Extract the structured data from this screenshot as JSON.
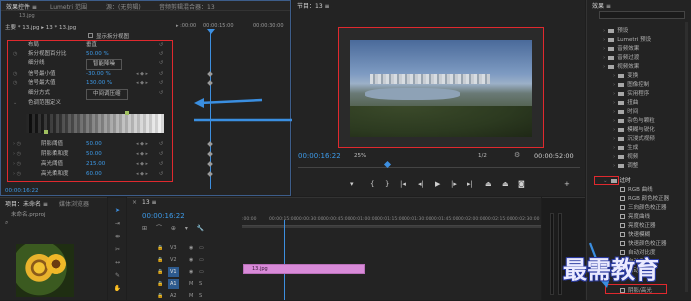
{
  "effect_controls": {
    "tabs": [
      "效果控件 ≡",
      "Lumetri 范围",
      "源：(无剪辑)",
      "音频剪辑混合器：13"
    ],
    "source_tab": "13.jpg",
    "clip_path": "主要 * 13.jpg ▸ 13 * 13.jpg",
    "timecodes": [
      "▸ :00:00",
      "00:00:15:00",
      "00:00:30:00"
    ],
    "show_split_view": "显示拆分视图",
    "rows": [
      {
        "label": "布局",
        "value": "垂直"
      },
      {
        "label": "拆分视图百分比",
        "value": "50.00 %"
      },
      {
        "label": "细分线",
        "value": "智能降噪"
      },
      {
        "label": "信号最小值",
        "value": "-30.00 %"
      },
      {
        "label": "信号最大值",
        "value": "130.00 %"
      },
      {
        "label": "细分方式",
        "value": "中间调压缩"
      },
      {
        "label": "色调范围定义",
        "value": ""
      },
      {
        "label": "阴影阈值",
        "value": "50.00"
      },
      {
        "label": "阴影柔和度",
        "value": "50.00"
      },
      {
        "label": "高光阈值",
        "value": "215.00"
      },
      {
        "label": "高光柔和度",
        "value": "60.00"
      }
    ],
    "bottom_timecode": "00:00:16:22"
  },
  "program_monitor": {
    "title": "节目：13 ≡",
    "timecode": "00:00:16:22",
    "zoom": "25%",
    "quality": "1/2",
    "duration": "00:00:52:00"
  },
  "project": {
    "tabs": [
      "项目：未命名 ≡",
      "媒体浏览器"
    ],
    "file": "未命名.prproj"
  },
  "timeline": {
    "title": "13 ≡",
    "timecode": "00:00:16:22",
    "ruler": [
      ":00:00",
      "00:00:15:00",
      "00:00:30:00",
      "00:00:45:00",
      "00:01:00:00",
      "00:01:15:00",
      "00:01:30:00",
      "00:01:45:00",
      "00:02:00:00",
      "00:02:15:00",
      "00:02:30:00"
    ],
    "tracks": [
      "V3",
      "V2",
      "V1",
      "A1",
      "A2"
    ],
    "clip": "13.jpg"
  },
  "effects_panel": {
    "title": "效果 ≡",
    "items": [
      {
        "label": "预设",
        "type": "folder"
      },
      {
        "label": "Lumetri 预设",
        "type": "folder"
      },
      {
        "label": "音频效果",
        "type": "folder"
      },
      {
        "label": "音频过渡",
        "type": "folder"
      },
      {
        "label": "视频效果",
        "type": "folder"
      },
      {
        "label": "变换",
        "type": "folder"
      },
      {
        "label": "图像控制",
        "type": "folder"
      },
      {
        "label": "实用程序",
        "type": "folder"
      },
      {
        "label": "扭曲",
        "type": "folder"
      },
      {
        "label": "时间",
        "type": "folder"
      },
      {
        "label": "杂色与颗粒",
        "type": "folder"
      },
      {
        "label": "模糊与锐化",
        "type": "folder"
      },
      {
        "label": "沉浸式视频",
        "type": "folder"
      },
      {
        "label": "生成",
        "type": "folder"
      },
      {
        "label": "视频",
        "type": "folder"
      },
      {
        "label": "调整",
        "type": "folder"
      },
      {
        "label": "过时",
        "type": "folder"
      },
      {
        "label": "RGB 曲线",
        "type": "fx"
      },
      {
        "label": "RGB 颜色校正器",
        "type": "fx"
      },
      {
        "label": "三向颜色校正器",
        "type": "fx"
      },
      {
        "label": "亮度曲线",
        "type": "fx"
      },
      {
        "label": "亮度校正器",
        "type": "fx"
      },
      {
        "label": "快速模糊",
        "type": "fx"
      },
      {
        "label": "快速颜色校正器",
        "type": "fx"
      },
      {
        "label": "自动对比度",
        "type": "fx"
      },
      {
        "label": "自动色阶",
        "type": "fx"
      },
      {
        "label": "自动颜色",
        "type": "fx"
      },
      {
        "label": "阴影/高光",
        "type": "fx"
      }
    ]
  },
  "watermark": "最需教育",
  "colors": {
    "highlight_red": "#e0292e",
    "arrow_blue": "#3a8ee0",
    "clip_pink": "#d88ad8"
  }
}
